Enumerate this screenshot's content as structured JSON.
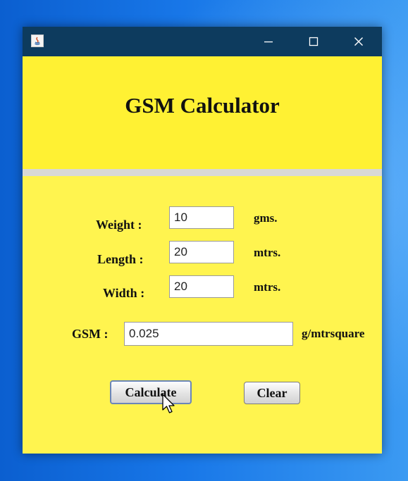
{
  "window": {
    "title_bar_icon": "java-icon",
    "controls": {
      "minimize_icon": "minimize-icon",
      "maximize_icon": "maximize-icon",
      "close_icon": "close-icon"
    }
  },
  "header": {
    "title": "GSM Calculator"
  },
  "form": {
    "weight": {
      "label": "Weight :",
      "value": "10",
      "unit": "gms."
    },
    "length": {
      "label": "Length :",
      "value": "20",
      "unit": "mtrs."
    },
    "width": {
      "label": "Width :",
      "value": "20",
      "unit": "mtrs."
    },
    "gsm": {
      "label": "GSM :",
      "value": "0.025",
      "unit": "g/mtrsquare"
    }
  },
  "actions": {
    "calculate_label": "Calculate",
    "clear_label": "Clear"
  },
  "colors": {
    "title_bar": "#0d3b5e",
    "header_bg": "#fff133",
    "body_bg": "#fff44f",
    "separator": "#d9d9d6",
    "desktop": "#1877e8"
  }
}
